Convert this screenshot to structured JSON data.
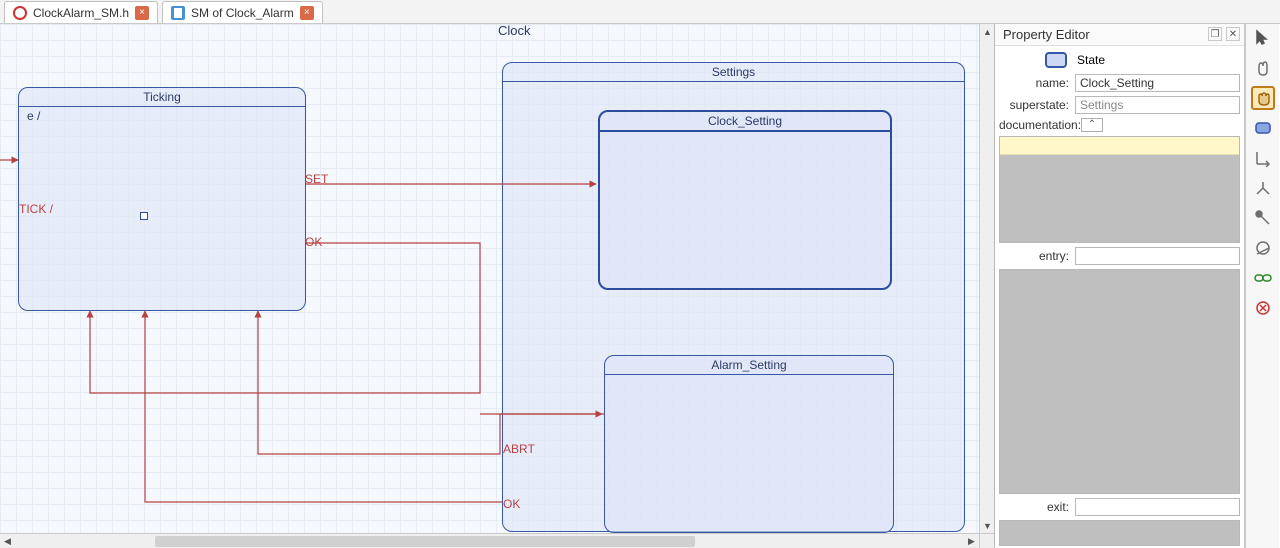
{
  "tabs": [
    {
      "label": "ClockAlarm_SM.h",
      "icon": "red",
      "closable": true
    },
    {
      "label": "SM of Clock_Alarm",
      "icon": "blue",
      "closable": true
    }
  ],
  "diagram": {
    "clock_label": "Clock",
    "ticking_label": "Ticking",
    "ticking_entry": "e /",
    "tick_label": "TICK /",
    "set_label": "SET",
    "ok1_label": "OK",
    "abrt_label": "ABRT",
    "ok2_label": "OK",
    "settings_label": "Settings",
    "clock_setting_label": "Clock_Setting",
    "alarm_setting_label": "Alarm_Setting"
  },
  "property_editor": {
    "title": "Property Editor",
    "type_label": "State",
    "name_label": "name:",
    "name_value": "Clock_Setting",
    "superstate_label": "superstate:",
    "superstate_value": "Settings",
    "documentation_label": "documentation:",
    "entry_label": "entry:",
    "exit_label": "exit:"
  },
  "palette": {
    "items": [
      "select-tool",
      "pan-tool",
      "grab-tool",
      "state-tool",
      "transition-tool",
      "initial-tool",
      "choice-tool",
      "history-tool",
      "link-tool",
      "delete-tool"
    ]
  }
}
